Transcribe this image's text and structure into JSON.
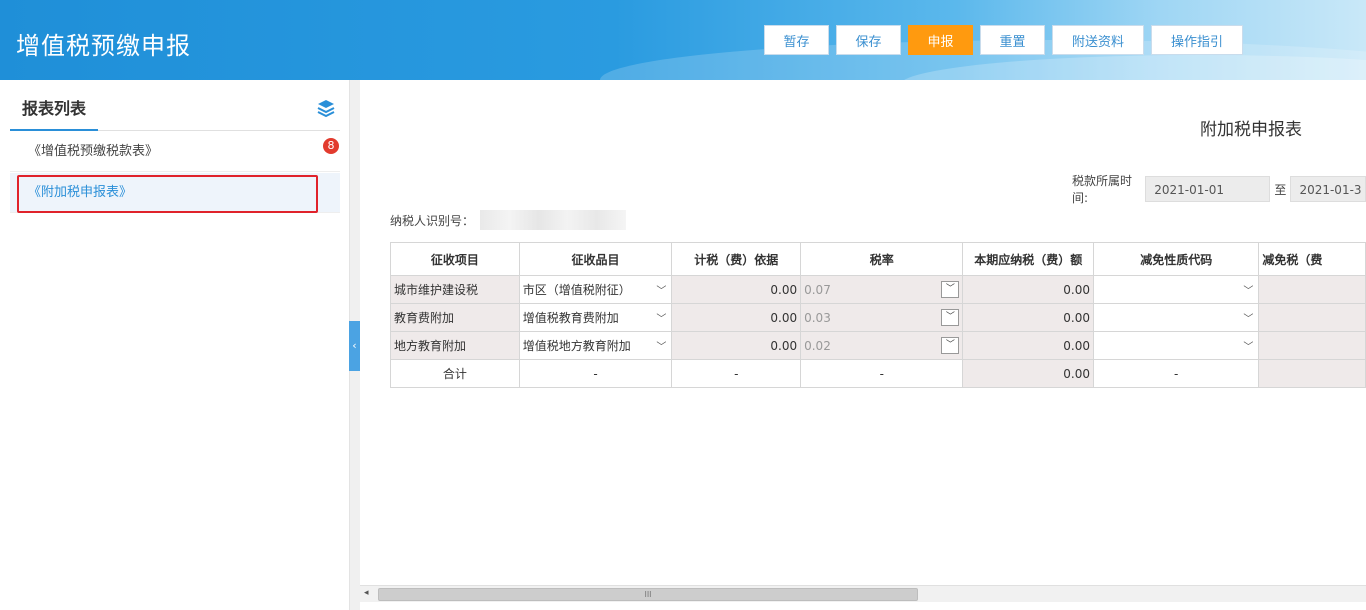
{
  "header": {
    "title": "增值税预缴申报",
    "buttons": [
      {
        "label": "暂存"
      },
      {
        "label": "保存"
      },
      {
        "label": "申报"
      },
      {
        "label": "重置"
      },
      {
        "label": "附送资料"
      },
      {
        "label": "操作指引"
      }
    ]
  },
  "sidebar": {
    "title": "报表列表",
    "icon": "layers-icon",
    "items": [
      {
        "label": "《增值税预缴税款表》",
        "badge": "8"
      },
      {
        "label": "《附加税申报表》"
      }
    ]
  },
  "form": {
    "title": "附加税申报表",
    "period_label": "税款所属时间:",
    "period_start": "2021-01-01",
    "period_to": "至",
    "period_end": "2021-01-3",
    "taxpayer_label": "纳税人识别号："
  },
  "table": {
    "headers": [
      "征收项目",
      "征收品目",
      "计税（费）依据",
      "税率",
      "本期应纳税（费）额",
      "减免性质代码",
      "减免税（费"
    ],
    "rows": [
      {
        "item": "城市维护建设税",
        "category": "市区（增值税附征）",
        "basis": "0.00",
        "rate": "0.07",
        "payable": "0.00"
      },
      {
        "item": "教育费附加",
        "category": "增值税教育费附加",
        "basis": "0.00",
        "rate": "0.03",
        "payable": "0.00"
      },
      {
        "item": "地方教育附加",
        "category": "增值税地方教育附加",
        "basis": "0.00",
        "rate": "0.02",
        "payable": "0.00"
      }
    ],
    "total": {
      "label": "合计",
      "category": "-",
      "basis": "-",
      "rate": "-",
      "payable": "0.00",
      "reduction_code": "-"
    }
  },
  "scrollbar": {
    "thumb_grip": "III"
  }
}
